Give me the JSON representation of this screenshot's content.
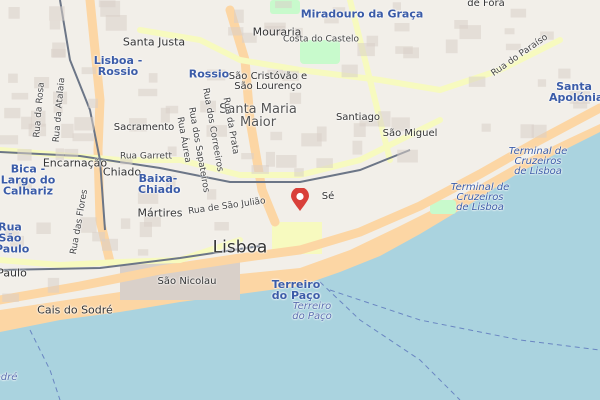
{
  "map": {
    "colors": {
      "water": "#aad3df",
      "land": "#f2efe9",
      "buildings": "#d9d0c9",
      "primary_road": "#fcd6a4",
      "secondary_road": "#f7fabf",
      "rail": "#6c7687",
      "station": "#3b5ca8",
      "marker": "#d9403a",
      "green": "#c8facc",
      "pedestrian": "#dddde8"
    },
    "labels": {
      "miradouro": "Miradouro da Graça",
      "fora": "de Fora",
      "santa_justa": "Santa Justa",
      "lisboa_rossio": "Lisboa - Rossio",
      "rossio": "Rossio",
      "mouraria": "Mouraria",
      "costa_castelo": "Costa do Castelo",
      "sao_cristovao": "São Cristóvão e São Lourenço",
      "santa_maria_maior": "Santa Maria Maior",
      "santiago": "Santiago",
      "sao_miguel": "São Miguel",
      "santa_apolonia": "Santa Apolónia",
      "rua_paraiso": "Rua do Paraíso",
      "sacramento": "Sacramento",
      "rua_garrett": "Rua Garrett",
      "chiado": "Chiado",
      "baixa_chiado": "Baixa-Chiado",
      "encarnacao": "Encarnação",
      "bica": "Bica - Largo do Calhariz",
      "martires": "Mártires",
      "rua_sao_juliao": "Rua de São Julião",
      "rua_aurea": "Rua Áurea",
      "rua_correeiros": "Rua dos Correeiros",
      "rua_sapateiros": "Rua dos Sapateiros",
      "rua_prata": "Rua da Prata",
      "rua_sao_paulo": "Rua São Paulo",
      "paulo": "Paulo",
      "lisboa": "Lisboa",
      "se": "Sé",
      "terminal_cruzeiros_1": "Terminal de Cruzeiros de Lisboa",
      "terminal_cruzeiros_2": "Terminal de Cruzeiros de Lisboa",
      "sao_nicolau": "São Nicolau",
      "terreiro_paco_station": "Terreiro do Paço",
      "terreiro_paco_water": "Terreiro do Paço",
      "cais_sodre": "Cais do Sodré",
      "rua_rosa": "Rua da Rosa",
      "rua_atalaia": "Rua da Atalaia",
      "rua_flores": "Rua das Flores",
      "odre": "odré"
    }
  }
}
